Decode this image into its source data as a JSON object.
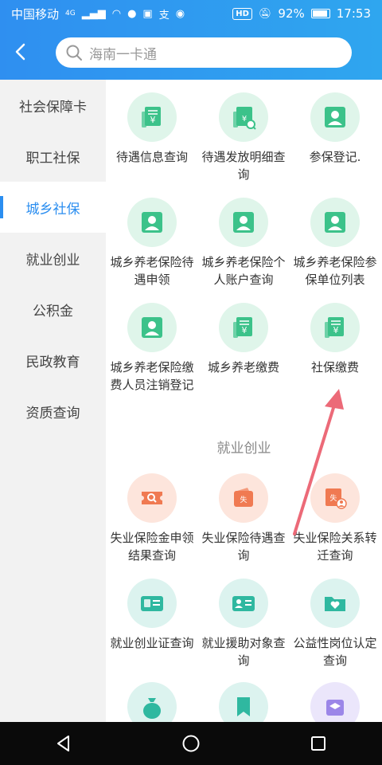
{
  "status": {
    "carrier": "中国移动",
    "network": "4G",
    "hd": "HD",
    "battery": "92%",
    "time": "17:53"
  },
  "search": {
    "placeholder": "海南一卡通"
  },
  "sidebar": {
    "items": [
      {
        "label": "社会保障卡"
      },
      {
        "label": "职工社保"
      },
      {
        "label": "城乡社保"
      },
      {
        "label": "就业创业"
      },
      {
        "label": "公积金"
      },
      {
        "label": "民政教育"
      },
      {
        "label": "资质查询"
      }
    ],
    "active_index": 2
  },
  "grid": {
    "tiles": [
      {
        "label": "待遇信息查询",
        "icon": "receipt-icon"
      },
      {
        "label": "待遇发放明细查询",
        "icon": "receipt-search-icon"
      },
      {
        "label": "参保登记.",
        "icon": "person-card-icon"
      },
      {
        "label": "城乡养老保险待遇申领",
        "icon": "person-card-icon"
      },
      {
        "label": "城乡养老保险个人账户查询",
        "icon": "person-card-icon"
      },
      {
        "label": "城乡养老保险参保单位列表",
        "icon": "person-card-icon"
      },
      {
        "label": "城乡养老保险缴费人员注销登记",
        "icon": "person-card-icon"
      },
      {
        "label": "城乡养老缴费",
        "icon": "receipt-icon"
      },
      {
        "label": "社保缴费",
        "icon": "receipt-icon"
      }
    ],
    "section_title": "就业创业",
    "tiles2": [
      {
        "label": "失业保险金申领结果查询",
        "icon": "ticket-search-icon"
      },
      {
        "label": "失业保险待遇查询",
        "icon": "wallet-icon"
      },
      {
        "label": "失业保险关系转迁查询",
        "icon": "transfer-person-icon"
      },
      {
        "label": "就业创业证查询",
        "icon": "id-card-icon"
      },
      {
        "label": "就业援助对象查询",
        "icon": "id-card-person-icon"
      },
      {
        "label": "公益性岗位认定查询",
        "icon": "heart-folder-icon"
      }
    ]
  },
  "colors": {
    "accent": "#2b8ef0",
    "green_icon": "#3cc28a",
    "orange_icon": "#f07a52",
    "teal_icon": "#2fb8a0",
    "arrow": "#ec6a78"
  }
}
